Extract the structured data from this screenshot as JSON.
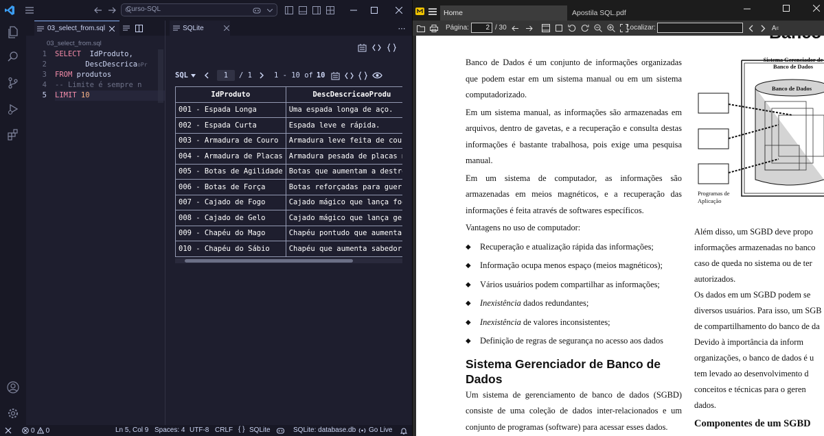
{
  "vscode": {
    "search_text": "Curso-SQL",
    "editor_tab": "03_select_from.sql",
    "breadcrumb": "03_select_from.sql",
    "line_numbers": [
      "1",
      "2",
      "3",
      "4",
      "5"
    ],
    "code": {
      "l1_kw": "SELECT",
      "l1_rest": "  IdProduto,",
      "l2_rest": "       DescDescrica",
      "l2_ghost": "oPr",
      "l3_kw": "FROM",
      "l3_rest": " produtos",
      "l4_comment": "-- Limite é sempre n",
      "l5_kw": "LIMIT",
      "l5_num": " 10"
    },
    "results_tab": "SQLite",
    "results": {
      "mode": "SQL",
      "page_current": "1",
      "page_total": "/ 1",
      "range": "1 - 10 of",
      "range_total": "10",
      "columns": [
        "IdProduto",
        "DescDescricaoProdu"
      ],
      "rows": [
        [
          "001 - Espada Longa",
          "Uma espada longa de aço."
        ],
        [
          "002 - Espada Curta",
          "Espada leve e rápida."
        ],
        [
          "003 - Armadura de Couro",
          "Armadura leve feita de couro"
        ],
        [
          "004 - Armadura de Placas",
          "Armadura pesada de placas met"
        ],
        [
          "005 - Botas de Agilidade",
          "Botas que aumentam a destreza"
        ],
        [
          "006 - Botas de Força",
          "Botas reforçadas para guerre"
        ],
        [
          "007 - Cajado de Fogo",
          "Cajado mágico que lança fogo"
        ],
        [
          "008 - Cajado de Gelo",
          "Cajado mágico que lança gelo"
        ],
        [
          "009 - Chapéu do Mago",
          "Chapéu pontudo que aumenta in"
        ],
        [
          "010 - Chapéu do Sábio",
          "Chapéu que aumenta sabedoria"
        ]
      ]
    },
    "status": {
      "errors": "0",
      "warnings": "0",
      "position": "Ln 5, Col 9",
      "spaces": "Spaces: 4",
      "encoding": "UTF-8",
      "eol": "CRLF",
      "language": "SQLite",
      "database": "SQLite: database.db",
      "live": "Go Live"
    }
  },
  "pdf": {
    "tab_home": "Home",
    "tab_doc": "Apostila SQL.pdf",
    "page_label": "Página:",
    "page_value": "2",
    "page_total": "/ 30",
    "find_label": "Localizar:",
    "heading_top": "Banco",
    "para1": "Banco de Dados é um conjunto de informações organizadas que podem estar em um sistema manual ou em um sistema computadorizado.",
    "para2": "Em um sistema manual, as informações são armazenadas em arquivos, dentro de gavetas, e a recuperação e consulta destas informações é bastante trabalhosa, pois exige uma pesquisa manual.",
    "para3": "Em um sistema de computador, as informações são armazenadas em meios magnéticos, e a recuperação das informações é feita através de softwares específicos.",
    "para4": "Vantagens no uso de computador:",
    "bullets": [
      "Recuperação e atualização rápida das informações;",
      "Informação ocupa menos espaço (meios magnéticos);",
      "Vários usuários podem compartilhar as informações;",
      "dados redundantes;",
      "de valores inconsistentes;",
      "Definição de regras de segurança no acesso aos dados"
    ],
    "bullet_italic": "Inexistência",
    "section_heading": "Sistema Gerenciador de Banco de Dados",
    "para5": "Um sistema de gerenciamento de banco de dados (SGBD) consiste de uma coleção de dados inter-relacionados e um conjunto de programas (software) para acessar esses dados.",
    "figure_title": "Sistema Gerenciador de Banco de Dados",
    "figure_cyl": "Banco de Dados",
    "figure_prog": "Programas de Aplicação",
    "right_lines": [
      "Além disso, um SGBD deve propo",
      "informações armazenadas no banco",
      "caso de queda no sistema ou de ter",
      "autorizados.",
      "Os dados em um SGBD podem se",
      "diversos usuários. Para isso, um SGB",
      "de compartilhamento do banco de da",
      "Devido à importância da inform",
      "organizações, o banco de dados é u",
      "tem levado ao desenvolvimento d",
      "conceitos e técnicas para o geren",
      "dados."
    ],
    "right_heading": "Componentes de um SGBD"
  }
}
